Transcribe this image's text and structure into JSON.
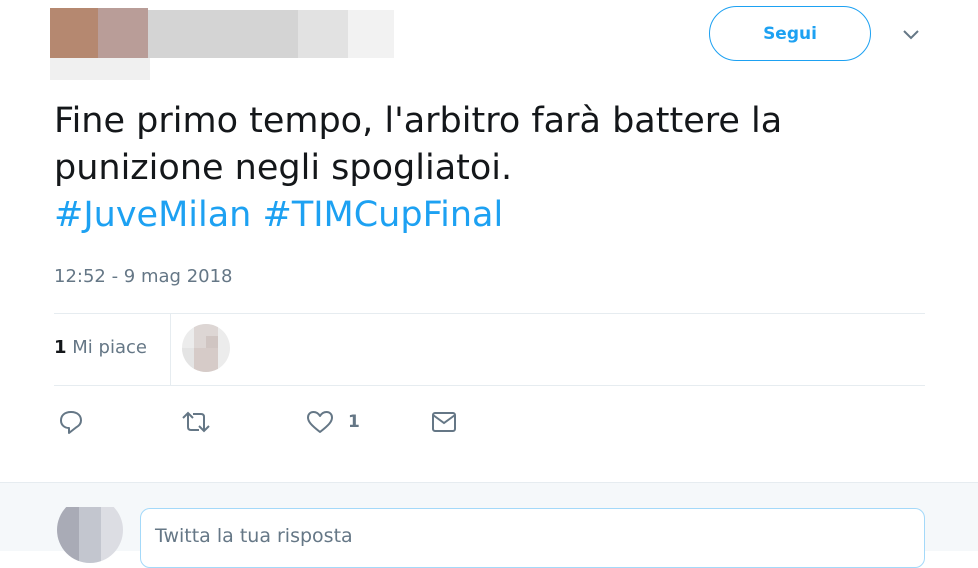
{
  "header": {
    "follow_label": "Segui",
    "menu_icon": "chevron-down-icon"
  },
  "tweet": {
    "text_line1": "Fine primo tempo, l'arbitro farà battere la",
    "text_line2": "punizione negli spogliatoi.",
    "hashtags": [
      "#JuveMilan",
      "#TIMCupFinal"
    ],
    "timestamp": "12:52 - 9 mag 2018"
  },
  "stats": {
    "likes_count": "1",
    "likes_label": "Mi piace"
  },
  "actions": {
    "reply_icon": "reply-icon",
    "retweet_icon": "retweet-icon",
    "like_icon": "heart-icon",
    "like_count": "1",
    "dm_icon": "envelope-icon"
  },
  "reply": {
    "placeholder": "Twitta la tua risposta"
  },
  "colors": {
    "accent": "#1da1f2",
    "secondary_text": "#657786",
    "divider": "#e6ecf0"
  }
}
